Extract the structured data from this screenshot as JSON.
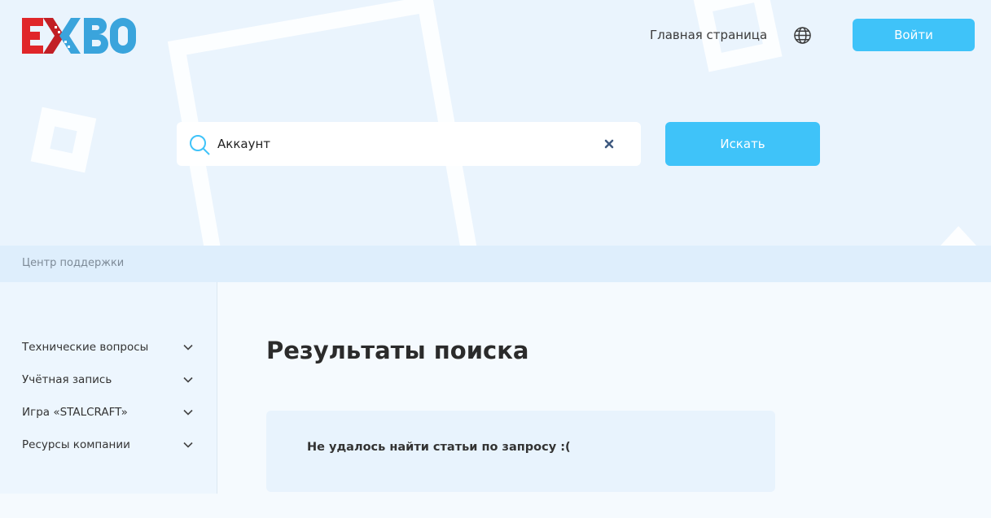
{
  "header": {
    "logo_text": "EXBO",
    "nav_home_label": "Главная страница",
    "globe_icon": "globe-icon",
    "login_label": "Войти"
  },
  "search": {
    "value": "Аккаунт",
    "button_label": "Искать",
    "icons": {
      "search": "search-icon",
      "clear": "close-icon"
    }
  },
  "breadcrumb": {
    "label": "Центр поддержки"
  },
  "sidebar": {
    "items": [
      {
        "label": "Технические вопросы"
      },
      {
        "label": "Учётная запись"
      },
      {
        "label": "Игра «STALCRAFT»"
      },
      {
        "label": "Ресурсы компании"
      }
    ]
  },
  "main": {
    "title": "Результаты поиска",
    "empty_message": "Не удалось найти статьи по запросу :("
  },
  "colors": {
    "accent": "#3fc3f9",
    "logo_red": "#e02629",
    "logo_blue": "#3aa4dc",
    "hero_bg": "#eaf4fd",
    "page_bg": "#f5fafe"
  }
}
